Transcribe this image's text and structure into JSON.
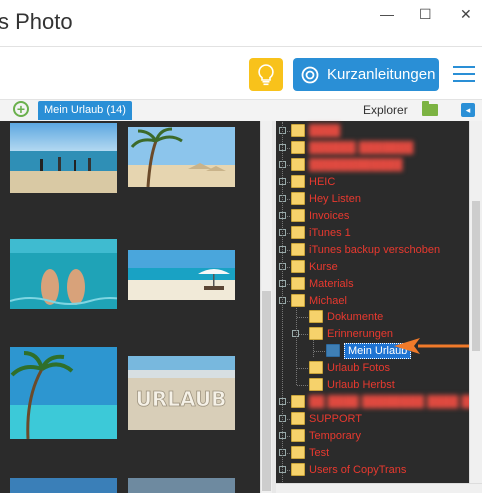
{
  "app": {
    "title": "s Photo"
  },
  "window": {
    "minimize": "—",
    "maximize": "☐",
    "close": "✕"
  },
  "toolbar": {
    "bulb_icon": "lightbulb-icon",
    "guides_label": "Kurzanleitungen",
    "menu_icon": "hamburger-menu-icon"
  },
  "tabs": {
    "add_icon": "plus-circle-icon",
    "active_album": "Mein Urlaub (14)"
  },
  "explorer": {
    "label": "Explorer",
    "collapse_glyph": "◂"
  },
  "tree": {
    "items": [
      {
        "label": "████",
        "blurred": true
      },
      {
        "label": "██████ ███████",
        "blurred": true
      },
      {
        "label": "████████████",
        "blurred": true
      },
      {
        "label": "HEIC",
        "blurred": false
      },
      {
        "label": "Hey Listen",
        "blurred": false
      },
      {
        "label": "Invoices",
        "blurred": false
      },
      {
        "label": "iTunes 1",
        "blurred": false
      },
      {
        "label": "iTunes backup verschoben",
        "blurred": false
      },
      {
        "label": "Kurse",
        "blurred": false
      },
      {
        "label": "Materials",
        "blurred": false
      },
      {
        "label": "Michael",
        "blurred": false
      },
      {
        "label": "Dokumente",
        "blurred": false
      },
      {
        "label": "Erinnerungen",
        "blurred": false
      },
      {
        "label": "Mein Urlaub",
        "blurred": false,
        "selected": true
      },
      {
        "label": "Urlaub Fotos",
        "blurred": false
      },
      {
        "label": "Urlaub Herbst",
        "blurred": false
      },
      {
        "label": "██ ████ ████████ ████ ███",
        "blurred": true
      },
      {
        "label": "SUPPORT",
        "blurred": false
      },
      {
        "label": "Temporary",
        "blurred": false
      },
      {
        "label": "Test",
        "blurred": false
      },
      {
        "label": "Users of CopyTrans",
        "blurred": false
      }
    ]
  },
  "colors": {
    "accent": "#2a8fd6",
    "bulb": "#f8c21b",
    "folder_text": "#e8392f",
    "arrow": "#f07a2a",
    "pane_bg": "#2b2b2b"
  }
}
